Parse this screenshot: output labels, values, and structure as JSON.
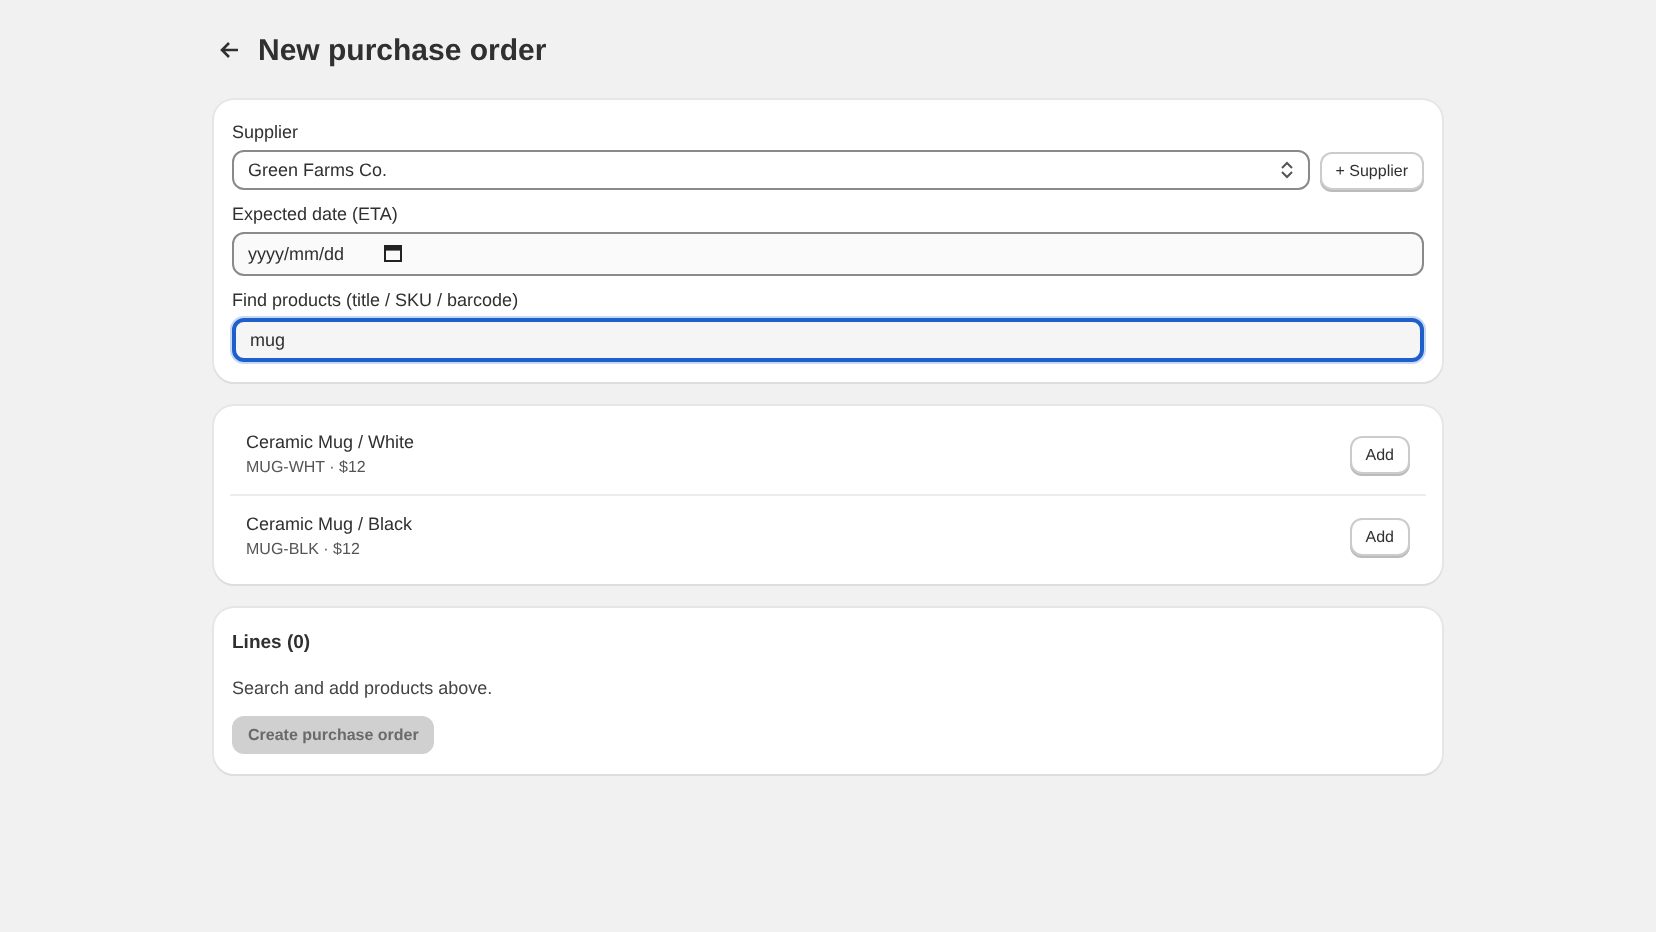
{
  "header": {
    "title": "New purchase order"
  },
  "form": {
    "supplier": {
      "label": "Supplier",
      "value": "Green Farms Co."
    },
    "add_supplier_button": "+ Supplier",
    "expected_date": {
      "label": "Expected date (ETA)",
      "placeholder": "yyyy/mm/dd"
    },
    "find_products": {
      "label": "Find products (title / SKU / barcode)",
      "value": "mug",
      "focused": true
    }
  },
  "results": [
    {
      "title": "Ceramic Mug / White",
      "meta": "MUG-WHT · $12",
      "button": "Add"
    },
    {
      "title": "Ceramic Mug / Black",
      "meta": "MUG-BLK · $12",
      "button": "Add"
    }
  ],
  "lines": {
    "title": "Lines (0)",
    "empty_text": "Search and add products above.",
    "create_button": {
      "label": "Create purchase order",
      "disabled": true
    }
  }
}
